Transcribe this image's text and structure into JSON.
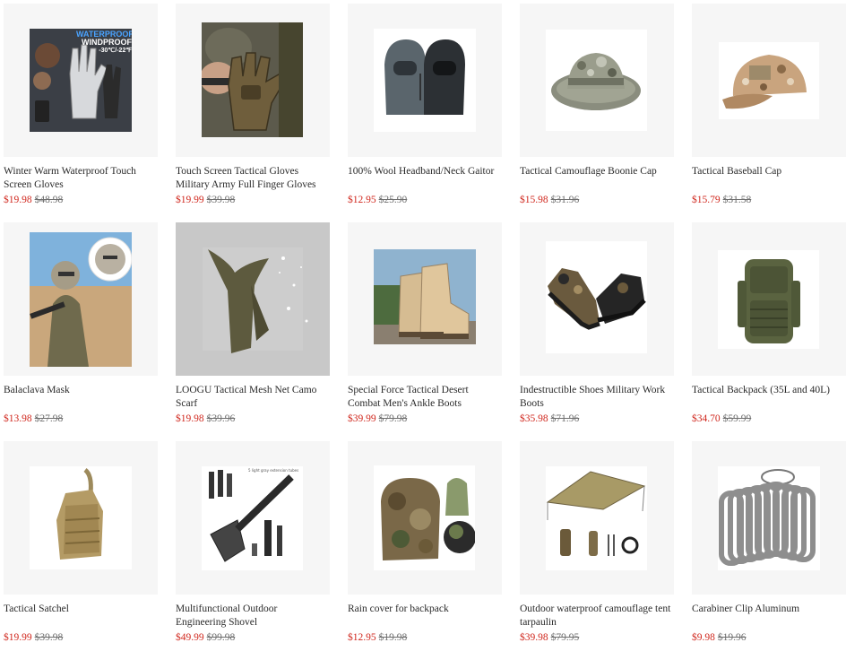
{
  "products": [
    {
      "title": "Winter Warm Waterproof Touch Screen Gloves",
      "price": "$19.98",
      "old_price": "$48.98",
      "icon": "gloves-icon",
      "badge_lines": [
        "WATERPROOF",
        "WINDPROOF"
      ],
      "badge_sub": "-30℃/-22℉"
    },
    {
      "title": "Touch Screen Tactical Gloves Military Army Full Finger Gloves",
      "price": "$19.99",
      "old_price": "$39.98",
      "icon": "tactical-gloves-icon"
    },
    {
      "title": "100% Wool Headband/Neck Gaitor",
      "price": "$12.95",
      "old_price": "$25.90",
      "icon": "neck-gaiter-icon"
    },
    {
      "title": "Tactical Camouflage Boonie Cap",
      "price": "$15.98",
      "old_price": "$31.96",
      "icon": "boonie-hat-icon"
    },
    {
      "title": "Tactical Baseball Cap",
      "price": "$15.79",
      "old_price": "$31.58",
      "icon": "baseball-cap-icon"
    },
    {
      "title": "Balaclava Mask",
      "price": "$13.98",
      "old_price": "$27.98",
      "icon": "balaclava-icon"
    },
    {
      "title": "LOOGU Tactical Mesh Net Camo Scarf",
      "price": "$19.98",
      "old_price": "$39.96",
      "icon": "scarf-icon"
    },
    {
      "title": "Special Force Tactical Desert Combat Men's Ankle Boots",
      "price": "$39.99",
      "old_price": "$79.98",
      "icon": "desert-boots-icon"
    },
    {
      "title": "Indestructible Shoes Military Work Boots",
      "price": "$35.98",
      "old_price": "$71.96",
      "icon": "camo-shoes-icon"
    },
    {
      "title": "Tactical Backpack (35L and 40L)",
      "price": "$34.70",
      "old_price": "$59.99",
      "icon": "backpack-icon"
    },
    {
      "title": "Tactical Satchel",
      "price": "$19.99",
      "old_price": "$39.98",
      "icon": "satchel-icon"
    },
    {
      "title": "Multifunctional Outdoor Engineering Shovel",
      "price": "$49.99",
      "old_price": "$99.98",
      "icon": "shovel-icon",
      "caption": "5 light gray extension tubes"
    },
    {
      "title": "Rain cover for backpack",
      "price": "$12.95",
      "old_price": "$19.98",
      "icon": "rain-cover-icon"
    },
    {
      "title": "Outdoor waterproof camouflage tent tarpaulin",
      "price": "$39.98",
      "old_price": "$79.95",
      "icon": "tarp-icon"
    },
    {
      "title": "Carabiner Clip Aluminum",
      "price": "$9.98",
      "old_price": "$19.96",
      "icon": "carabiner-icon"
    }
  ],
  "colors": {
    "price": "#d0271d",
    "old_price": "#6e6e6e",
    "tile_bg": "#f6f6f6"
  }
}
